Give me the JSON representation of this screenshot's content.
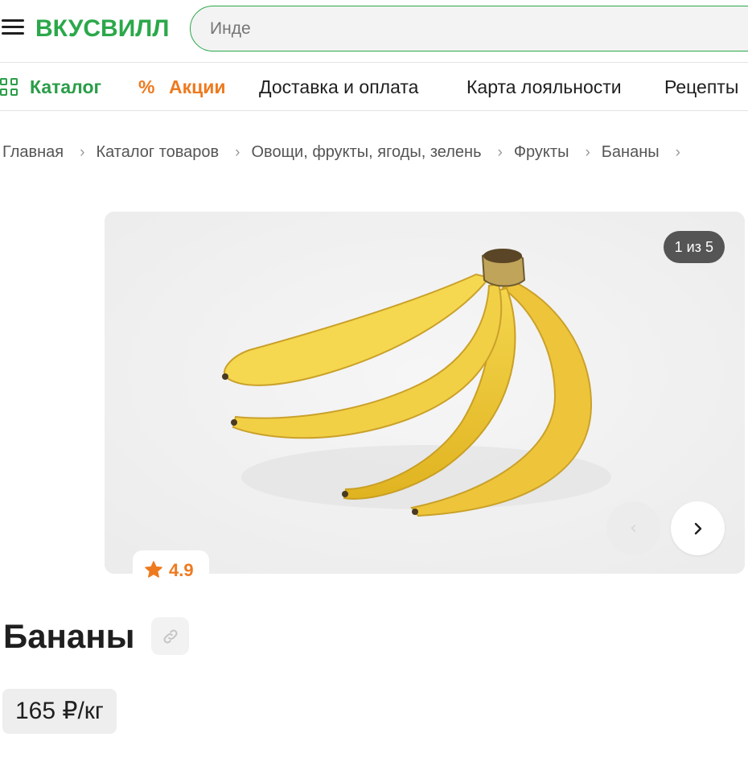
{
  "header": {
    "logo": "ВКУСВИЛЛ",
    "search_placeholder": "Инде"
  },
  "nav": {
    "catalog": "Каталог",
    "promo_icon": "%",
    "promo": "Акции",
    "delivery": "Доставка и оплата",
    "loyalty": "Карта лояльности",
    "recipes": "Рецепты"
  },
  "breadcrumbs": [
    "Главная",
    "Каталог товаров",
    "Овощи, фрукты, ягоды, зелень",
    "Фрукты",
    "Бананы"
  ],
  "gallery": {
    "counter": "1 из 5",
    "rating": "4.9"
  },
  "product": {
    "title": "Бананы",
    "price": "165 ₽/кг"
  },
  "colors": {
    "brand_green": "#2ba84a",
    "promo_orange": "#ee7a1f"
  },
  "icons": [
    "menu-icon",
    "catalog-grid-icon",
    "percent-icon",
    "chevron-right-icon",
    "chevron-left-icon",
    "star-icon",
    "link-icon"
  ]
}
